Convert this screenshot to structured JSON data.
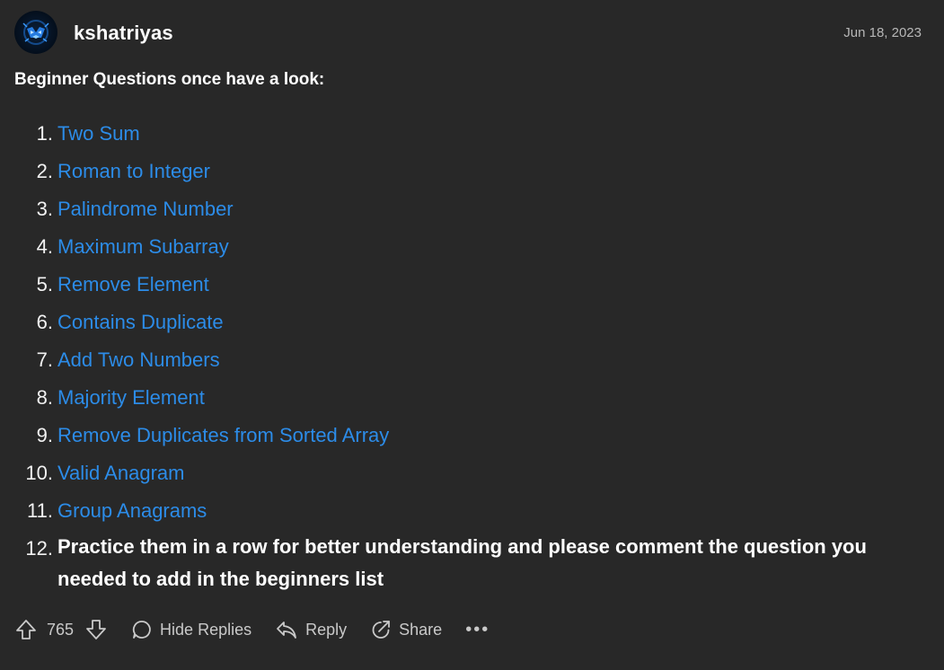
{
  "author": {
    "username": "kshatriyas",
    "date": "Jun 18, 2023"
  },
  "post": {
    "title": "Beginner Questions once have a look:",
    "questions": [
      {
        "num": "1.",
        "label": "Two Sum"
      },
      {
        "num": "2.",
        "label": "Roman to Integer"
      },
      {
        "num": "3.",
        "label": "Palindrome Number"
      },
      {
        "num": "4.",
        "label": "Maximum Subarray"
      },
      {
        "num": "5.",
        "label": "Remove Element"
      },
      {
        "num": "6.",
        "label": "Contains Duplicate"
      },
      {
        "num": "7.",
        "label": "Add Two Numbers"
      },
      {
        "num": "8.",
        "label": "Majority Element"
      },
      {
        "num": "9.",
        "label": "Remove Duplicates from Sorted Array"
      },
      {
        "num": "10.",
        "label": "Valid Anagram"
      },
      {
        "num": "11.",
        "label": "Group Anagrams"
      }
    ],
    "final_note": {
      "num": "12.",
      "text": "Practice them in a row for better understanding and please comment the question you needed to add in the beginners list"
    }
  },
  "actions": {
    "vote_count": "765",
    "hide_replies_label": "Hide Replies",
    "reply_label": "Reply",
    "share_label": "Share",
    "more_label": "•••"
  },
  "colors": {
    "background": "#282828",
    "link": "#2c8ce8",
    "text": "#ffffff",
    "muted": "#c9c9c9"
  }
}
